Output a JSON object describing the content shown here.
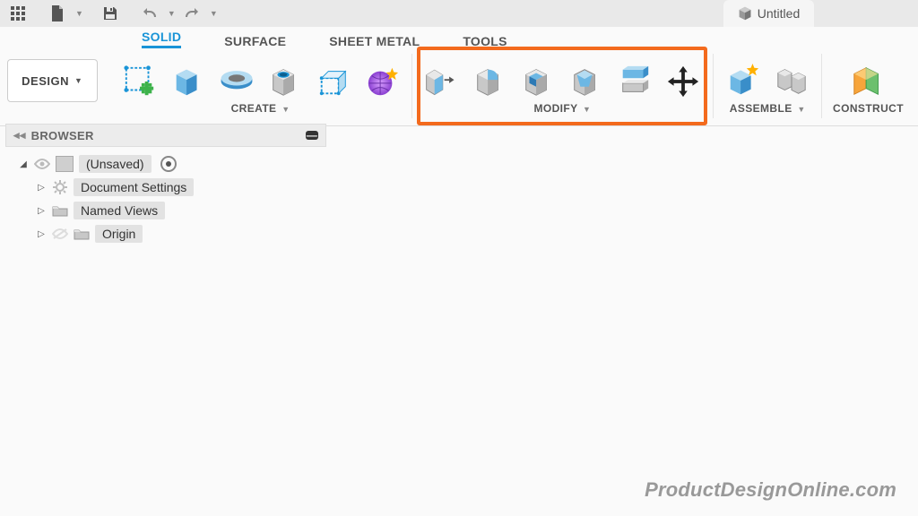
{
  "qat": {
    "document_title": "Untitled"
  },
  "workspace": {
    "label": "DESIGN"
  },
  "env_tabs": {
    "solid": "SOLID",
    "surface": "SURFACE",
    "sheet_metal": "SHEET METAL",
    "tools": "TOOLS"
  },
  "panels": {
    "create": "CREATE",
    "modify": "MODIFY",
    "assemble": "ASSEMBLE",
    "construct": "CONSTRUCT"
  },
  "browser": {
    "title": "BROWSER",
    "root": "(Unsaved)",
    "items": [
      "Document Settings",
      "Named Views",
      "Origin"
    ]
  },
  "watermark": "ProductDesignOnline.com"
}
